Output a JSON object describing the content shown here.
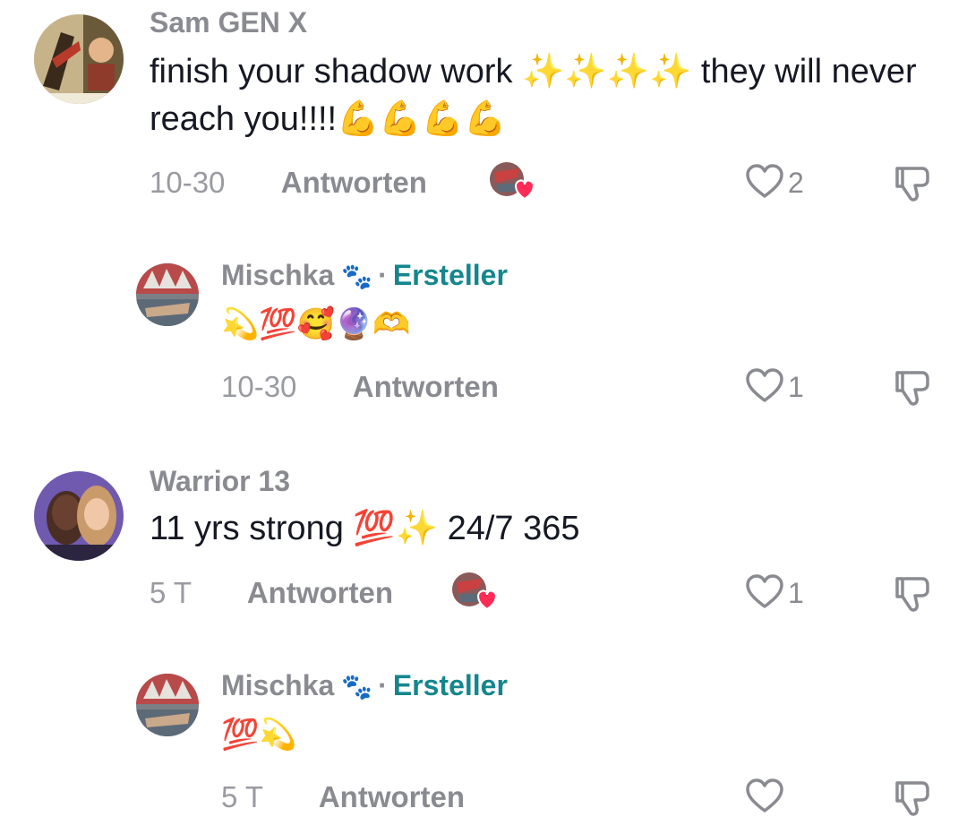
{
  "comments": [
    {
      "username": "Sam GEN X",
      "text": "finish your shadow work ✨✨✨✨ they will never reach you!!!!💪💪💪💪",
      "date": "10-30",
      "reply_label": "Antworten",
      "likes": "2",
      "creator_liked": true,
      "avatar_icon": "retro-collage-avatar"
    },
    {
      "username": "Mischka",
      "username_badge": "🐾",
      "creator_label": "Ersteller",
      "separator": "·",
      "text": "💫💯🥰🔮🫶",
      "date": "10-30",
      "reply_label": "Antworten",
      "likes": "1",
      "avatar_icon": "graffiti-avatar"
    },
    {
      "username": "Warrior 13",
      "text": "11 yrs strong 💯✨ 24/7 365",
      "date": "5 T",
      "reply_label": "Antworten",
      "likes": "1",
      "creator_liked": true,
      "avatar_icon": "couple-photo-avatar"
    },
    {
      "username": "Mischka",
      "username_badge": "🐾",
      "creator_label": "Ersteller",
      "separator": "·",
      "text": "💯💫",
      "date": "5 T",
      "reply_label": "Antworten",
      "likes": "",
      "avatar_icon": "graffiti-avatar"
    }
  ],
  "colors": {
    "creator": "#14868d",
    "muted": "#8a8b91",
    "text": "#161823",
    "heart_badge": "#fe2c55"
  }
}
